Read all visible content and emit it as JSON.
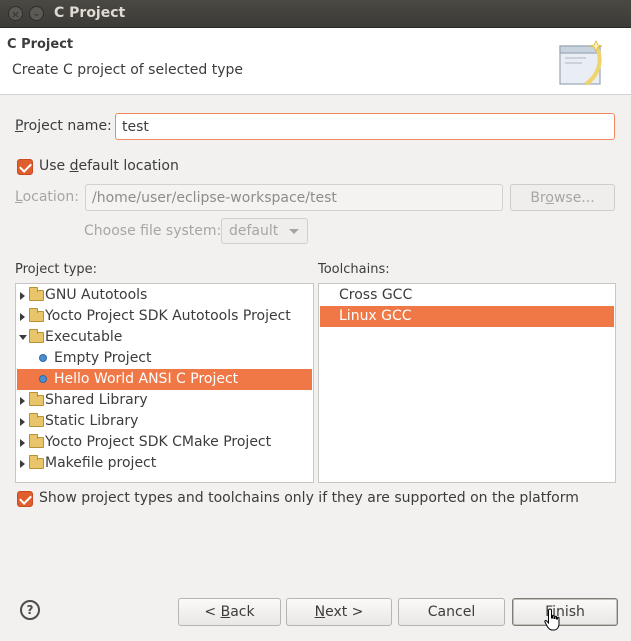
{
  "window": {
    "title": "C Project",
    "close_glyph": "×",
    "minimize_glyph": "–"
  },
  "header": {
    "title": "C Project",
    "description": "Create C project of selected type"
  },
  "project_name": {
    "label_mnemonic": "P",
    "label_rest": "roject name:",
    "value": "test"
  },
  "use_default_location": {
    "label_prefix": "Use ",
    "label_mnemonic": "d",
    "label_rest": "efault location",
    "checked": true
  },
  "location": {
    "label_mnemonic": "L",
    "label_rest": "ocation:",
    "value": "/home/user/eclipse-workspace/test",
    "browse_prefix": "Br",
    "browse_mnemonic": "o",
    "browse_rest": "wse..."
  },
  "file_system": {
    "label": "Choose file system:",
    "value": "default"
  },
  "project_type": {
    "label": "Project type:",
    "items": [
      {
        "label": "GNU Autotools",
        "kind": "folder",
        "expanded": false,
        "selected": false
      },
      {
        "label": "Yocto Project SDK Autotools Project",
        "kind": "folder",
        "expanded": false,
        "selected": false
      },
      {
        "label": "Executable",
        "kind": "folder",
        "expanded": true,
        "selected": false
      },
      {
        "label": "Empty Project",
        "kind": "leaf",
        "selected": false
      },
      {
        "label": "Hello World ANSI C Project",
        "kind": "leaf",
        "selected": true
      },
      {
        "label": "Shared Library",
        "kind": "folder",
        "expanded": false,
        "selected": false
      },
      {
        "label": "Static Library",
        "kind": "folder",
        "expanded": false,
        "selected": false
      },
      {
        "label": "Yocto Project SDK CMake Project",
        "kind": "folder",
        "expanded": false,
        "selected": false
      },
      {
        "label": "Makefile project",
        "kind": "folder",
        "expanded": false,
        "selected": false
      }
    ]
  },
  "toolchains": {
    "label": "Toolchains:",
    "items": [
      {
        "label": "Cross GCC",
        "selected": false
      },
      {
        "label": "Linux GCC",
        "selected": true
      }
    ]
  },
  "show_supported": {
    "label": "Show project types and toolchains only if they are supported on the platform",
    "checked": true
  },
  "buttons": {
    "help": "?",
    "back_prefix": "< ",
    "back_mnemonic": "B",
    "back_rest": "ack",
    "next_prefix": "",
    "next_mnemonic": "N",
    "next_rest": "ext >",
    "cancel": "Cancel",
    "finish": "Finish"
  },
  "colors": {
    "selection": "#f07746",
    "checkbox": "#e05d2c",
    "titlebar": "#3c3b37"
  }
}
